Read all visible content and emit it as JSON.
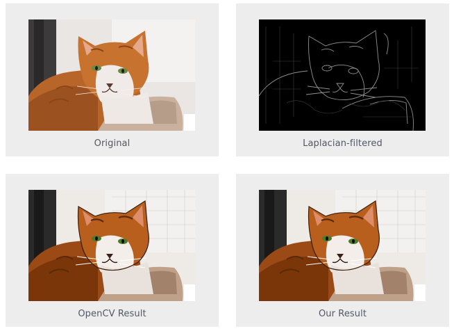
{
  "panels": [
    {
      "caption": "Original"
    },
    {
      "caption": "Laplacian-filtered"
    },
    {
      "caption": "OpenCV Result"
    },
    {
      "caption": "Our Result"
    }
  ]
}
